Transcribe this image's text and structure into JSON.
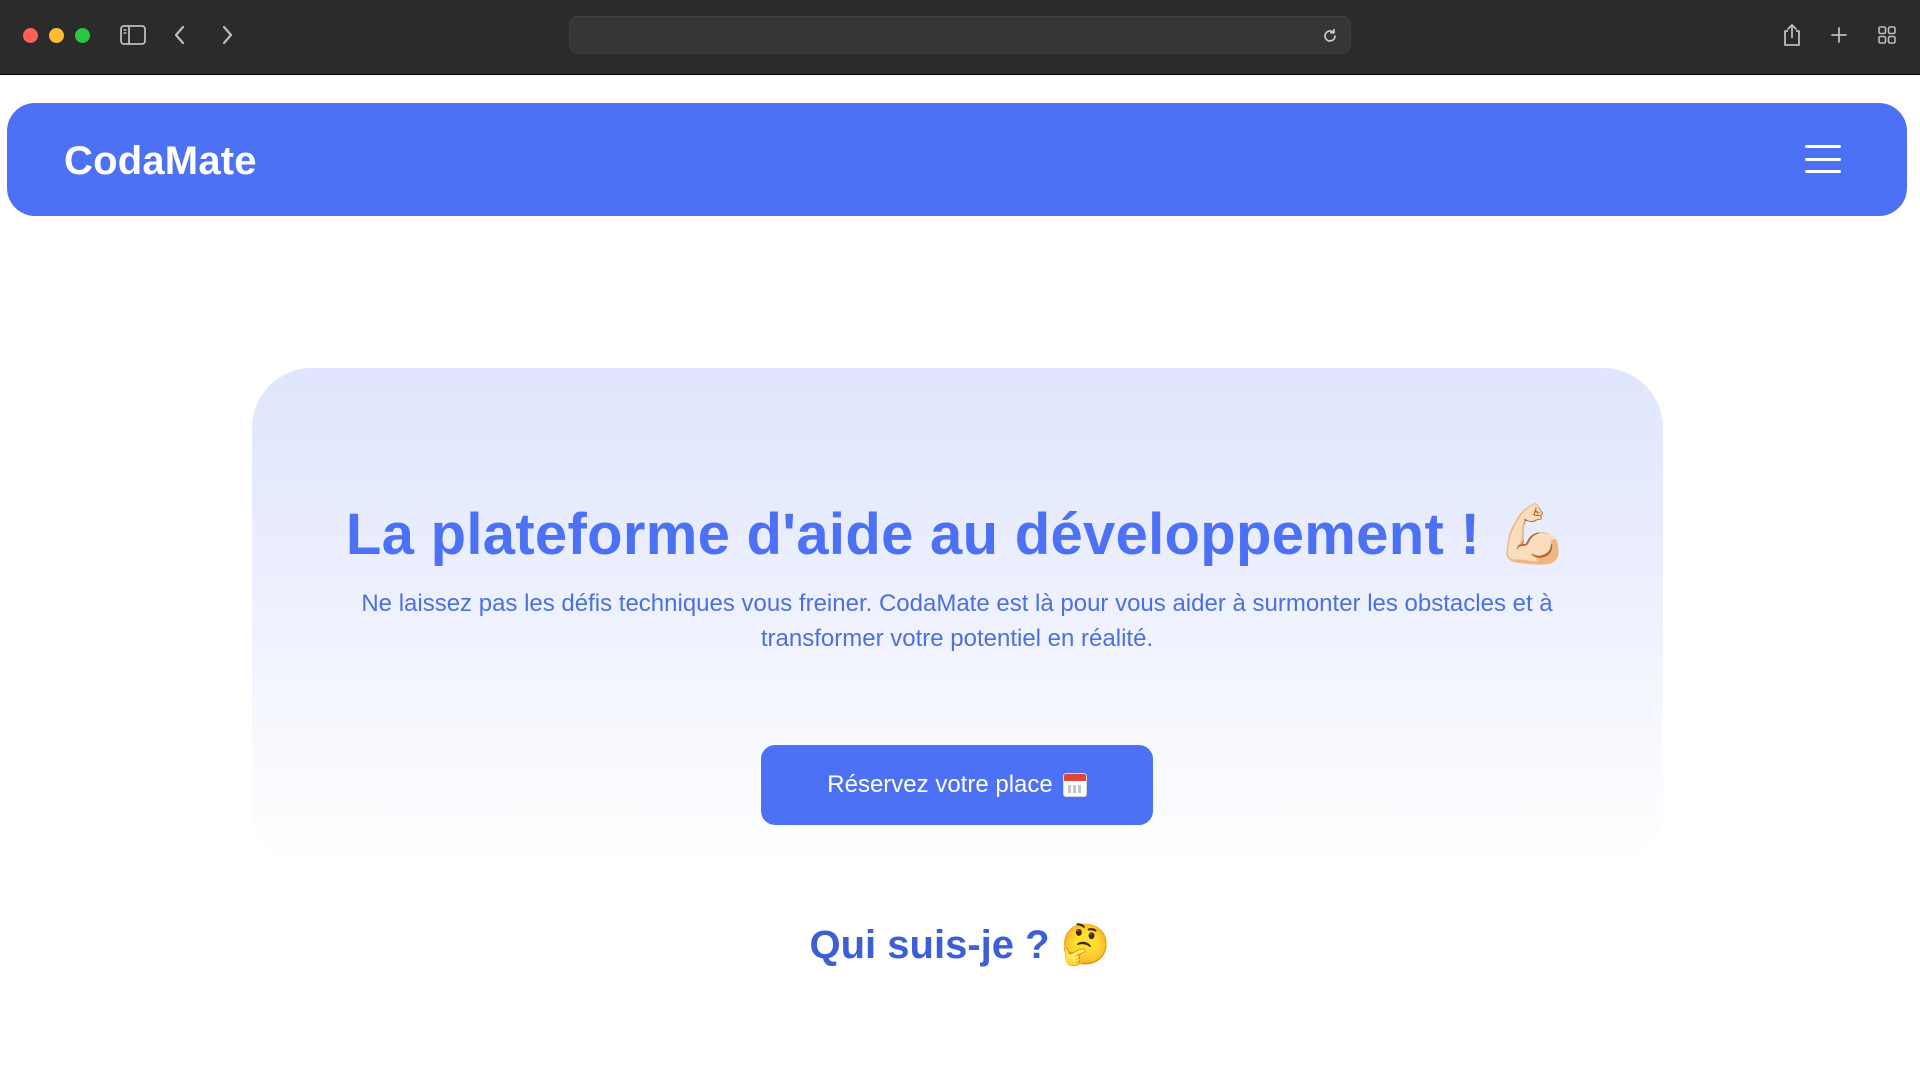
{
  "browser": {
    "url": "",
    "icons": {
      "sidebar": "sidebar-icon",
      "back": "chevron-left-icon",
      "forward": "chevron-right-icon",
      "reload": "reload-icon",
      "share": "share-icon",
      "new_tab": "plus-icon",
      "tab_overview": "grid-icon"
    }
  },
  "navbar": {
    "brand": "CodaMate",
    "menu_icon": "hamburger-icon",
    "color": "#4d71f5"
  },
  "hero": {
    "title": "La plateforme d'aide au développement !",
    "title_emoji": "💪🏻",
    "description": "Ne laissez pas les défis techniques vous freiner. CodaMate est là pour vous aider à surmonter les obstacles et à transformer votre potentiel en réalité.",
    "cta_label": "Réservez votre place",
    "cta_icon": "calendar-icon"
  },
  "about": {
    "title": "Qui suis-je ?",
    "emoji": "🤔"
  }
}
